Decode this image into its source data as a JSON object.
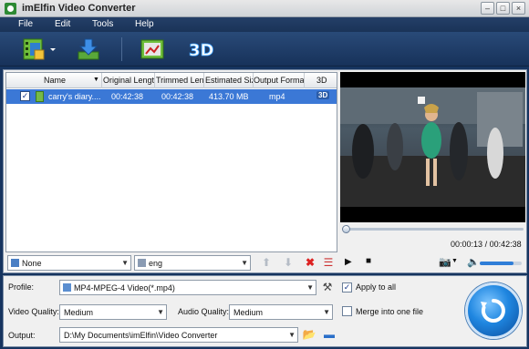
{
  "window": {
    "title": "imElfin Video Converter"
  },
  "menu": {
    "items": [
      "File",
      "Edit",
      "Tools",
      "Help"
    ]
  },
  "file_list": {
    "columns": [
      "Name",
      "Original Length",
      "Trimmed Length",
      "Estimated Size",
      "Output Format",
      "3D"
    ],
    "rows": [
      {
        "checked": true,
        "name": "carry's diary....",
        "original_length": "00:42:38",
        "trimmed_length": "00:42:38",
        "estimated_size": "413.70 MB",
        "output_format": "mp4",
        "three_d": "3D"
      }
    ]
  },
  "subtitle_select": {
    "value": "None"
  },
  "audio_track_select": {
    "value": "eng"
  },
  "player": {
    "current_time": "00:00:13",
    "total_time": "00:42:38",
    "time_separator": "/",
    "progress": 0.005,
    "volume": 0.8
  },
  "settings": {
    "profile_label": "Profile:",
    "profile_value": "MP4-MPEG-4 Video(*.mp4)",
    "apply_to_all_label": "Apply to all",
    "apply_to_all_checked": true,
    "video_quality_label": "Video Quality:",
    "video_quality_value": "Medium",
    "audio_quality_label": "Audio Quality:",
    "audio_quality_value": "Medium",
    "merge_label": "Merge into one file",
    "merge_checked": false,
    "output_label": "Output:",
    "output_value": "D:\\My Documents\\imElfin\\Video Converter"
  },
  "colors": {
    "accent": "#3b78d6",
    "toolbar": "#1f3d66",
    "convert": "#1f86e0"
  }
}
